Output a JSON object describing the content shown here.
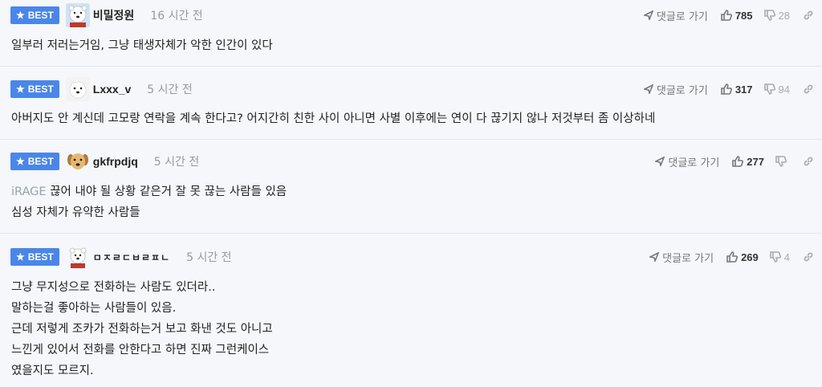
{
  "badge_label": "BEST",
  "colors": {
    "badge": "#4a86e8",
    "row_bg": "#f5f7fb"
  },
  "comments": [
    {
      "author": "비밀정원",
      "time": "16 시간 전",
      "reply_label": "댓글로 가기",
      "upvotes": "785",
      "downvotes": "28",
      "lines": [
        "일부러 저러는거임, 그냥 태생자체가 악한 인간이 있다"
      ]
    },
    {
      "author": "Lxxx_v",
      "time": "5 시간 전",
      "reply_label": "댓글로 가기",
      "upvotes": "317",
      "downvotes": "94",
      "lines": [
        "아버지도 안 계신데 고모랑 연락을 계속 한다고? 어지간히 친한 사이 아니면 사별 이후에는 연이 다 끊기지 않나 저것부터 좀 이상하네"
      ]
    },
    {
      "author": "gkfrpdjq",
      "time": "5 시간 전",
      "reply_label": "댓글로 가기",
      "upvotes": "277",
      "downvotes": "",
      "tag": "iRAGE",
      "lines": [
        "끊어 내야 될 상황 같은거 잘 못 끊는 사람들 있음",
        "심성 자체가 유약한 사람들"
      ]
    },
    {
      "author": "ㅁㅈㄹㄷㅂㄹㅍㄴ",
      "time": "5 시간 전",
      "reply_label": "댓글로 가기",
      "upvotes": "269",
      "downvotes": "4",
      "lines": [
        "그냥 무지성으로 전화하는 사람도 있더라..",
        "말하는걸 좋아하는 사람들이 있음.",
        "근데 저렇게 조카가 전화하는거 보고 화낸 것도 아니고",
        "느낀게 있어서 전화를 안한다고 하면 진짜 그런케이스",
        "였을지도 모르지."
      ]
    }
  ]
}
